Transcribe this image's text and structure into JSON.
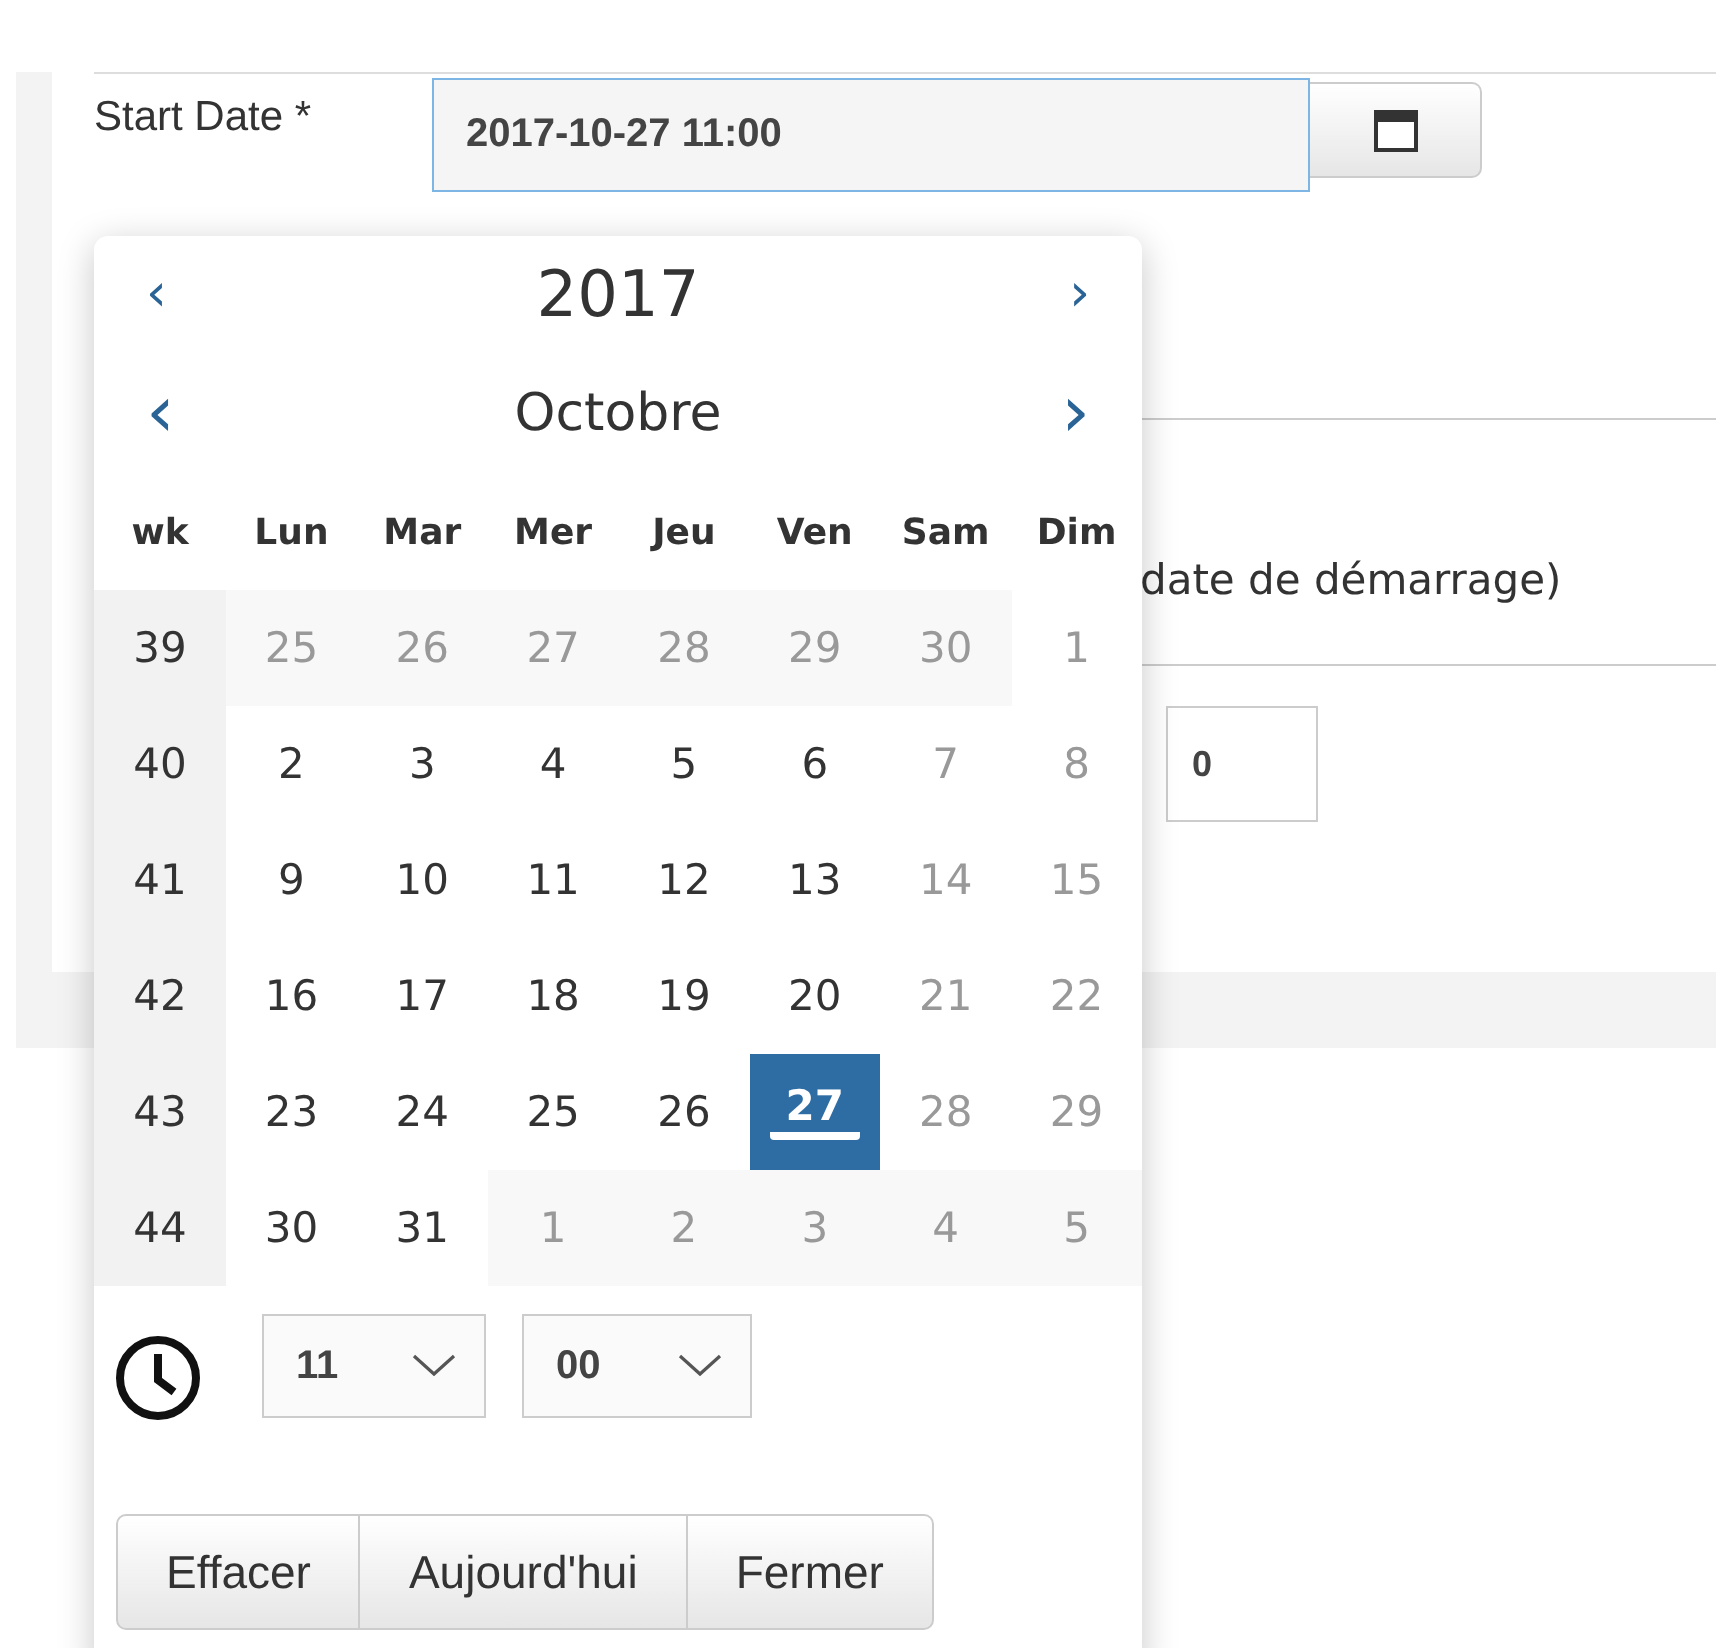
{
  "form": {
    "start_date": {
      "label": "Start Date *",
      "value": "2017-10-27 11:00"
    },
    "hint_text": "date de démarrage)",
    "number_field": {
      "value": "0"
    }
  },
  "datepicker": {
    "year": "2017",
    "month": "Octobre",
    "prev_year": "‹",
    "next_year": "›",
    "prev_month": "‹",
    "next_month": "›",
    "headers": [
      "wk",
      "Lun",
      "Mar",
      "Mer",
      "Jeu",
      "Ven",
      "Sam",
      "Dim"
    ],
    "weeks": [
      {
        "week": "39",
        "days": [
          {
            "day": "25",
            "kind": "outside",
            "selected": false
          },
          {
            "day": "26",
            "kind": "outside",
            "selected": false
          },
          {
            "day": "27",
            "kind": "outside",
            "selected": false
          },
          {
            "day": "28",
            "kind": "outside",
            "selected": false
          },
          {
            "day": "29",
            "kind": "outside",
            "selected": false
          },
          {
            "day": "30",
            "kind": "outside",
            "selected": false
          },
          {
            "day": "1",
            "kind": "weekend",
            "selected": false
          }
        ]
      },
      {
        "week": "40",
        "days": [
          {
            "day": "2",
            "kind": "current",
            "selected": false
          },
          {
            "day": "3",
            "kind": "current",
            "selected": false
          },
          {
            "day": "4",
            "kind": "current",
            "selected": false
          },
          {
            "day": "5",
            "kind": "current",
            "selected": false
          },
          {
            "day": "6",
            "kind": "current",
            "selected": false
          },
          {
            "day": "7",
            "kind": "weekend",
            "selected": false
          },
          {
            "day": "8",
            "kind": "weekend",
            "selected": false
          }
        ]
      },
      {
        "week": "41",
        "days": [
          {
            "day": "9",
            "kind": "current",
            "selected": false
          },
          {
            "day": "10",
            "kind": "current",
            "selected": false
          },
          {
            "day": "11",
            "kind": "current",
            "selected": false
          },
          {
            "day": "12",
            "kind": "current",
            "selected": false
          },
          {
            "day": "13",
            "kind": "current",
            "selected": false
          },
          {
            "day": "14",
            "kind": "weekend",
            "selected": false
          },
          {
            "day": "15",
            "kind": "weekend",
            "selected": false
          }
        ]
      },
      {
        "week": "42",
        "days": [
          {
            "day": "16",
            "kind": "current",
            "selected": false
          },
          {
            "day": "17",
            "kind": "current",
            "selected": false
          },
          {
            "day": "18",
            "kind": "current",
            "selected": false
          },
          {
            "day": "19",
            "kind": "current",
            "selected": false
          },
          {
            "day": "20",
            "kind": "current",
            "selected": false
          },
          {
            "day": "21",
            "kind": "weekend",
            "selected": false
          },
          {
            "day": "22",
            "kind": "weekend",
            "selected": false
          }
        ]
      },
      {
        "week": "43",
        "days": [
          {
            "day": "23",
            "kind": "current",
            "selected": false
          },
          {
            "day": "24",
            "kind": "current",
            "selected": false
          },
          {
            "day": "25",
            "kind": "current",
            "selected": false
          },
          {
            "day": "26",
            "kind": "current",
            "selected": false
          },
          {
            "day": "27",
            "kind": "current",
            "selected": true
          },
          {
            "day": "28",
            "kind": "weekend",
            "selected": false
          },
          {
            "day": "29",
            "kind": "weekend",
            "selected": false
          }
        ]
      },
      {
        "week": "44",
        "days": [
          {
            "day": "30",
            "kind": "current",
            "selected": false
          },
          {
            "day": "31",
            "kind": "current",
            "selected": false
          },
          {
            "day": "1",
            "kind": "outside",
            "selected": false
          },
          {
            "day": "2",
            "kind": "outside",
            "selected": false
          },
          {
            "day": "3",
            "kind": "outside",
            "selected": false
          },
          {
            "day": "4",
            "kind": "outside",
            "selected": false
          },
          {
            "day": "5",
            "kind": "outside",
            "selected": false
          }
        ]
      }
    ],
    "time": {
      "hour": "11",
      "minute": "00"
    },
    "buttons": [
      "Effacer",
      "Aujourd'hui",
      "Fermer"
    ]
  }
}
